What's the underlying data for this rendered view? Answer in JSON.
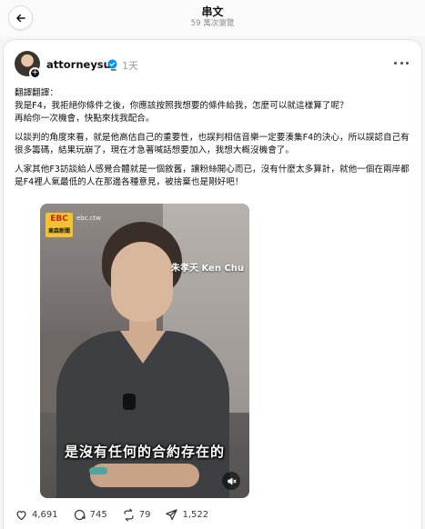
{
  "header": {
    "title": "串文",
    "subtitle": "59 萬次瀏覽"
  },
  "post": {
    "username": "attorneysu_",
    "time": "1天",
    "paragraphs": [
      "翻譯翻譯：\n我是F4，我拒絕你條件之後，你應該按照我想要的條件給我，怎麼可以就這樣算了呢？\n再給你一次機會，快點來找我配合。",
      "以談判的角度來看，就是他高估自己的重要性，也誤判相信音樂一定要湊集F4的決心，所以誤認自己有很多籌碼，結果玩崩了，現在才急著喊話想要加入，我想大概沒機會了。",
      "人家其他F3訪談給人感覺合體就是一個敘舊，讓粉絲開心而已，沒有什麼太多算計，就他一個在兩岸都是F4裡人氣最低的人在那邊各種意見，被捨棄也是剛好吧！"
    ]
  },
  "media": {
    "logo_main": "EBC",
    "logo_sub": "東森新聞",
    "channel": "ebc.ctw",
    "name_caption": "朱孝天 Ken Chu",
    "subtitle": "是沒有任何的合約存在的"
  },
  "actions": {
    "likes": "4,691",
    "comments": "745",
    "reposts": "79",
    "shares": "1,522"
  },
  "colors": {
    "verified": "#0095f6",
    "logo_bg": "#f2c230"
  }
}
